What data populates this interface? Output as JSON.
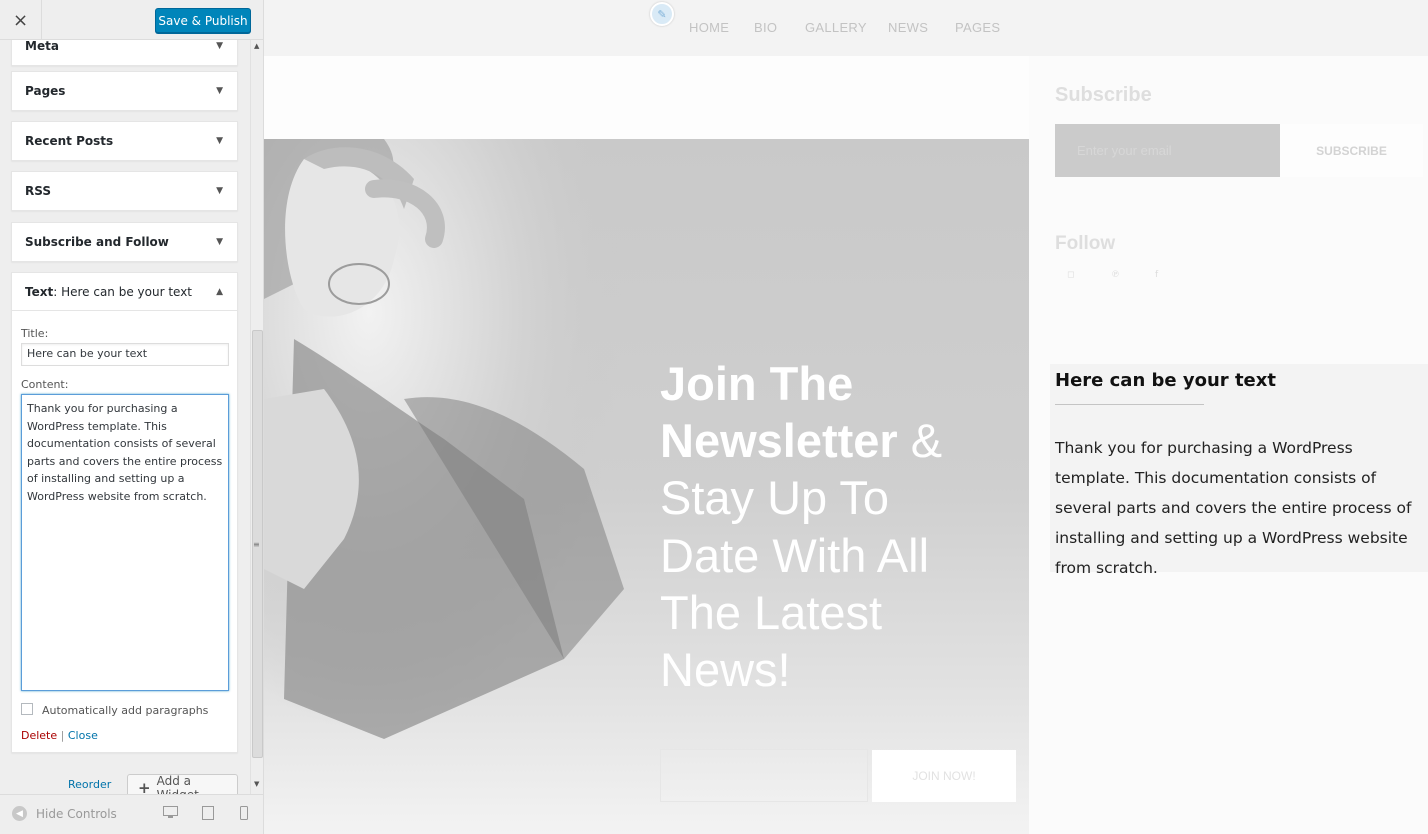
{
  "header": {
    "close_label": "×",
    "save_label": "Save & Publish"
  },
  "sidebar": {
    "widgets": [
      {
        "label": "Meta"
      },
      {
        "label": "Pages"
      },
      {
        "label": "Recent Posts"
      },
      {
        "label": "RSS"
      },
      {
        "label": "Subscribe and Follow"
      }
    ],
    "text_widget": {
      "head_type": "Text",
      "head_title": ": Here can be your text",
      "title_label": "Title:",
      "title_value": "Here can be your text",
      "content_label": "Content:",
      "content_value": "Thank you for purchasing a WordPress template. This documentation consists of several parts and covers the entire process of installing and setting up a WordPress website from scratch.",
      "auto_paragraphs_label": "Automatically add paragraphs",
      "delete_label": "Delete",
      "separator": "|",
      "close_label": "Close"
    },
    "reorder_label": "Reorder",
    "add_widget_label": "Add a Widget",
    "add_widget_plus": "+",
    "hide_controls_label": "Hide Controls"
  },
  "preview": {
    "nav": [
      "HOME",
      "BIO",
      "GALLERY",
      "NEWS",
      "PAGES"
    ],
    "hero": {
      "line1": "Join The",
      "line2_bold": "Newsletter",
      "line2_rest": " &",
      "line3": "Stay Up To",
      "line4": "Date With All",
      "line5": "The Latest",
      "line6": "News!",
      "button_label": "JOIN NOW!"
    },
    "subscribe": {
      "title": "Subscribe",
      "placeholder": "Enter your email",
      "button_label": "SUBSCRIBE"
    },
    "follow": {
      "title": "Follow",
      "icons": [
        "instagram-icon",
        "pinterest-icon",
        "facebook-icon"
      ]
    },
    "text_widget": {
      "title": "Here can be your text",
      "body": "Thank you for purchasing a WordPress template. This documentation consists of several parts and covers the entire process of installing and setting up a WordPress website from scratch."
    }
  },
  "colors": {
    "primary_button": "#0085ba",
    "link": "#0073aa",
    "delete": "#aa0000",
    "focus_border": "#5b9dd9"
  }
}
